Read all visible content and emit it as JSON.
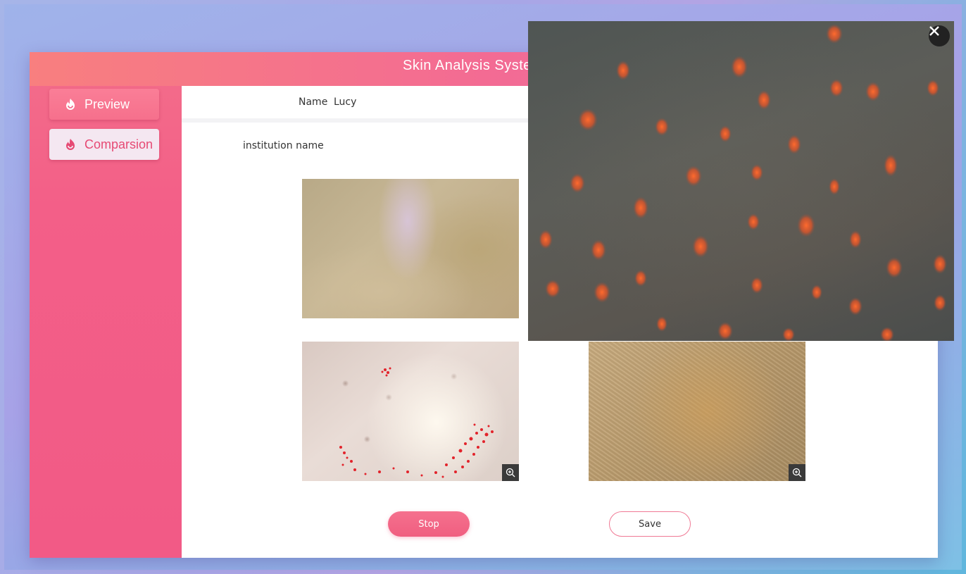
{
  "app": {
    "title": "Skin Analysis System"
  },
  "sidebar": {
    "items": [
      {
        "label": "Preview",
        "icon": "flame-icon"
      },
      {
        "label": "Comparsion",
        "icon": "flame-icon"
      }
    ]
  },
  "main": {
    "name_label": "Name",
    "name_value": "Lucy",
    "institution_label": "institution name",
    "buttons": {
      "stop": "Stop",
      "save": "Save"
    }
  },
  "overlay": {
    "close_icon": "close-icon"
  },
  "colors": {
    "accent": "#f35f88",
    "accent_light": "#f4e7f1",
    "overlay_spot": "#e85a2a"
  }
}
